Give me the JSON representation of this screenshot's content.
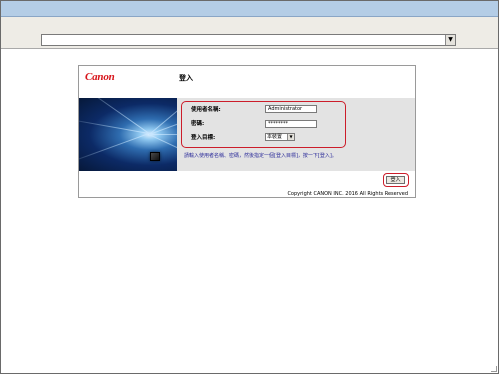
{
  "browser": {
    "address_value": "",
    "address_dropdown_icon": "triangle-down-glyph"
  },
  "page": {
    "logo": "Canon",
    "title": "登入",
    "fields": {
      "username_label": "使用者名稱:",
      "username_value": "Administrator",
      "password_label": "密碼:",
      "password_value": "********",
      "destination_label": "登入目標:",
      "destination_value": "本裝置"
    },
    "hint": "請輸入使用者名稱、密碼，然後指定一個[登入目標]，按一下[登入]。",
    "login_button": "登入",
    "copyright": "Copyright CANON INC. 2016 All Rights Reserved"
  },
  "colors": {
    "brand_red": "#d7141a",
    "highlight_red": "#cc1d2a",
    "hint_blue": "#2a2a99",
    "titlebar": "#b4cde6"
  }
}
